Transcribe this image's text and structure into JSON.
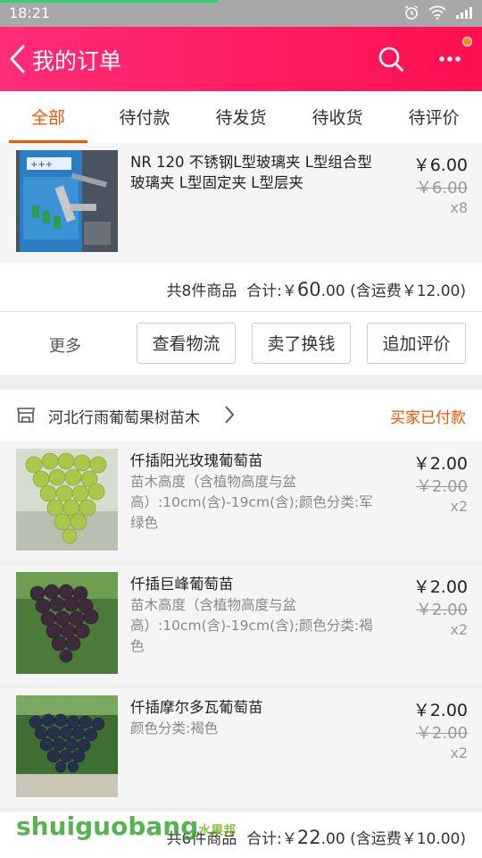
{
  "status_bar": {
    "time": "18:21"
  },
  "header": {
    "title": "我的订单"
  },
  "tabs": [
    {
      "label": "全部"
    },
    {
      "label": "待付款"
    },
    {
      "label": "待发货"
    },
    {
      "label": "待收货"
    },
    {
      "label": "待评价"
    }
  ],
  "order1": {
    "item": {
      "title": "NR 120 不锈钢L型玻璃夹 L型组合型玻璃夹 L型固定夹 L型层夹",
      "price": "￥6.00",
      "orig_price": "￥6.00",
      "qty": "x8"
    },
    "summary": {
      "count": "共8件商品",
      "total_label": "合计:",
      "currency": "￥",
      "total_int": "60",
      "total_dec": ".00",
      "shipping": "(含运费￥12.00)"
    },
    "actions": {
      "more": "更多",
      "logistics": "查看物流",
      "resell": "卖了换钱",
      "review": "追加评价"
    }
  },
  "order2": {
    "shop_name": "河北行雨葡萄果树苗木",
    "status": "买家已付款",
    "items": [
      {
        "title": "仟插阳光玫瑰葡萄苗",
        "spec": "苗木高度（含植物高度与盆高）:10cm(含)-19cm(含);颜色分类:军绿色",
        "price": "￥2.00",
        "orig_price": "￥2.00",
        "qty": "x2"
      },
      {
        "title": "仟插巨峰葡萄苗",
        "spec": "苗木高度（含植物高度与盆高）:10cm(含)-19cm(含);颜色分类:褐色",
        "price": "￥2.00",
        "orig_price": "￥2.00",
        "qty": "x2"
      },
      {
        "title": "仟插摩尔多瓦葡萄苗",
        "spec": "颜色分类:褐色",
        "price": "￥2.00",
        "orig_price": "￥2.00",
        "qty": "x2"
      }
    ],
    "summary": {
      "count": "共6件商品",
      "total_label": "合计:",
      "currency": "￥",
      "total_int": "22",
      "total_dec": ".00",
      "shipping": "(含运费￥10.00)"
    }
  },
  "watermark": {
    "text": "shuiguobang",
    "cn": "水果邦"
  },
  "colors": {
    "accent": "#ff4f00",
    "header": "#ff1a5e",
    "status": "#ff5000"
  }
}
